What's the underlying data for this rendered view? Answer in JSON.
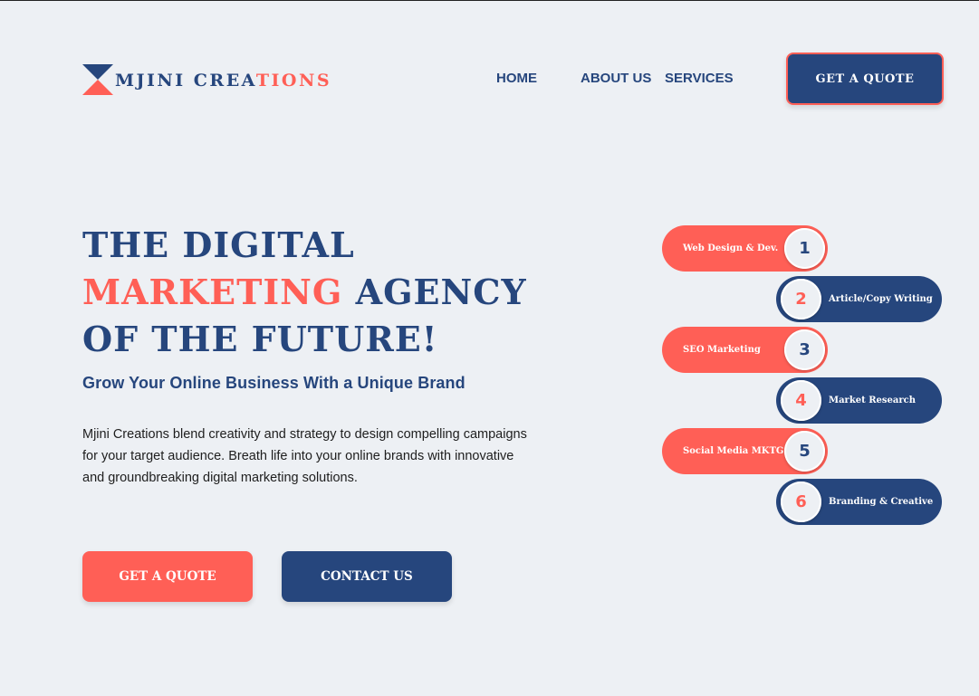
{
  "brand": {
    "name_part1": "MJINI CREA",
    "name_part2": "TIONS",
    "colors": {
      "navy": "#26467d",
      "coral": "#ff5f56",
      "background": "#edf0f4"
    }
  },
  "nav": {
    "home": "HOME",
    "about": "ABOUT US",
    "services": "SERVICES",
    "quote_button": "GET A QUOTE"
  },
  "hero": {
    "line1": "THE DIGITAL",
    "line2_accent": "MARKETING",
    "line2_rest": " AGENCY",
    "line3": "OF THE FUTURE!",
    "subtitle": "Grow Your Online Business With a Unique Brand",
    "body": "Mjini Creations blend creativity and strategy to design compelling campaigns for your target audience. Breath life into your online brands with innovative and groundbreaking digital marketing solutions.",
    "quote_button": "GET A QUOTE",
    "contact_button": "CONTACT US"
  },
  "services": [
    {
      "number": "1",
      "label": "Web Design & Dev."
    },
    {
      "number": "2",
      "label": "Article/Copy Writing"
    },
    {
      "number": "3",
      "label": "SEO Marketing"
    },
    {
      "number": "4",
      "label": "Market Research"
    },
    {
      "number": "5",
      "label": "Social Media MKTG"
    },
    {
      "number": "6",
      "label": "Branding & Creative"
    }
  ]
}
